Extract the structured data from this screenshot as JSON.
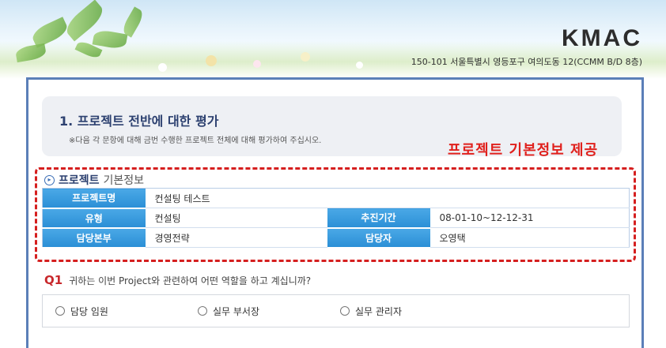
{
  "header": {
    "logo": "KMAC",
    "address": "150-101 서울특별시 영등포구 여의도동 12(CCMM B/D 8층)"
  },
  "section": {
    "title": "1. 프로젝트 전반에 대한 평가",
    "note": "※다음 각 문항에 대해 금번 수행한 프로젝트 전체에 대해 평가하여 주십시오."
  },
  "annotation": "프로젝트 기본정보 제공",
  "project_info": {
    "heading_strong": "프로젝트",
    "heading_light": "기본정보",
    "rows": [
      {
        "label1": "프로젝트명",
        "value1": "컨설팅 테스트"
      },
      {
        "label1": "유형",
        "value1": "컨설팅",
        "label2": "추진기간",
        "value2": "08-01-10~12-12-31"
      },
      {
        "label1": "담당본부",
        "value1": "경영전략",
        "label2": "담당자",
        "value2": "오영택"
      }
    ]
  },
  "question": {
    "number": "Q1",
    "text": "귀하는 이번 Project와 관련하여 어떤 역할을 하고 계십니까?",
    "options": [
      "담당 임원",
      "실무 부서장",
      "실무 관리자"
    ]
  },
  "colors": {
    "frame_border": "#5b7fb8",
    "table_header": "#2b8fd6",
    "annotation": "#e0201c",
    "question_number": "#c8282c"
  }
}
